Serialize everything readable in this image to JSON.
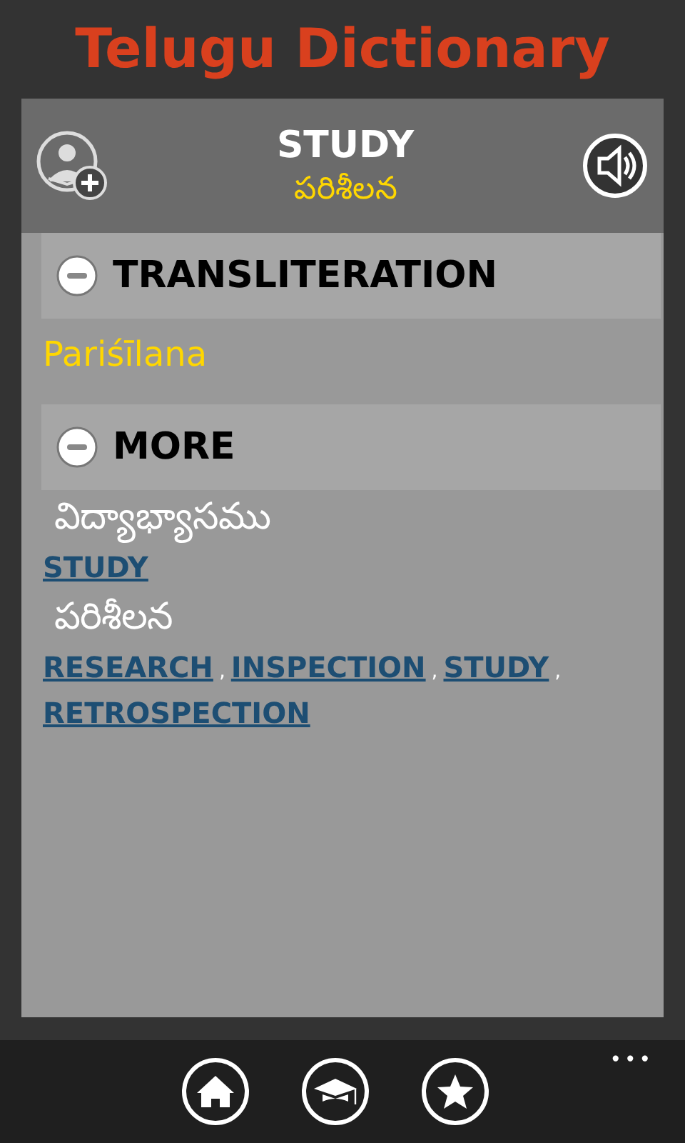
{
  "app_title": "Telugu Dictionary",
  "word": {
    "english": "STUDY",
    "telugu": "పరిశీలన"
  },
  "sections": [
    {
      "title": "TRANSLITERATION",
      "expanded": true,
      "entries": [
        {
          "kind": "transliteration",
          "text": "Pariśīlana"
        }
      ]
    },
    {
      "title": "MORE",
      "expanded": true,
      "entries": [
        {
          "kind": "telugu",
          "text": "విద్యాభ్యాసము"
        },
        {
          "kind": "links",
          "links": [
            "STUDY"
          ]
        },
        {
          "kind": "telugu",
          "text": "పరిశీలన"
        },
        {
          "kind": "links",
          "links": [
            "RESEARCH",
            "INSPECTION",
            "STUDY",
            "RETROSPECTION"
          ],
          "separator": ","
        }
      ]
    }
  ],
  "app_bar": {
    "buttons": [
      {
        "kind": "home"
      },
      {
        "kind": "learn"
      },
      {
        "kind": "favorites"
      }
    ],
    "more": "•••"
  }
}
